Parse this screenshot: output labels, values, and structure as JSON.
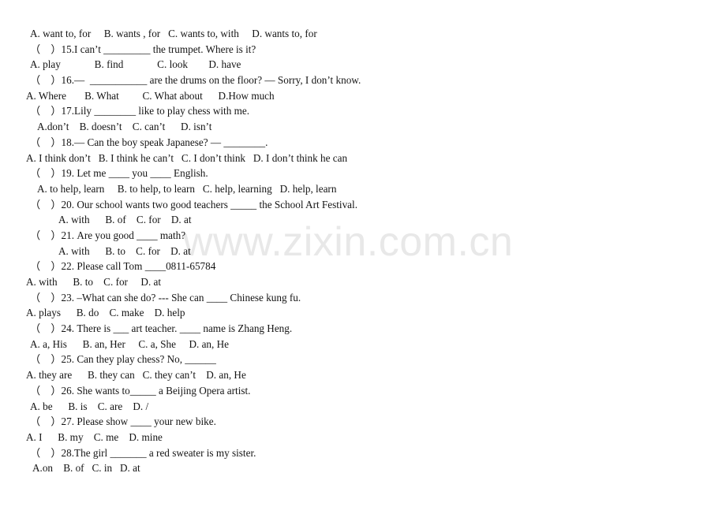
{
  "document": {
    "type": "english-grammar-worksheet",
    "watermark": {
      "text": "www.zixin.com.cn",
      "color": "#e8e8e8"
    },
    "lines": [
      {
        "id": "opts-14",
        "kind": "options",
        "indent": 1,
        "text": "A. want to, for     B. wants , for   C. wants to, with     D. wants to, for"
      },
      {
        "id": "q-15",
        "kind": "question",
        "indent": 1,
        "text": "（    ）15.I can’t _________ the trumpet. Where is it?"
      },
      {
        "id": "opts-15",
        "kind": "options",
        "indent": 1,
        "text": "A. play             B. find             C. look        D. have"
      },
      {
        "id": "q-16",
        "kind": "question",
        "indent": 1,
        "text": "（    ）16.—  ___________ are the drums on the floor? — Sorry, I don’t know."
      },
      {
        "id": "opts-16",
        "kind": "options",
        "indent": 0,
        "text": "A. Where       B. What         C. What about      D.How much"
      },
      {
        "id": "q-17",
        "kind": "question",
        "indent": 1,
        "text": "（    ）17.Lily ________ like to play chess with me."
      },
      {
        "id": "opts-17",
        "kind": "options",
        "indent": 3,
        "text": "A.don’t    B. doesn’t    C. can’t      D. isn’t"
      },
      {
        "id": "q-18",
        "kind": "question",
        "indent": 1,
        "text": "（    ）18.— Can the boy speak Japanese? — ________."
      },
      {
        "id": "opts-18",
        "kind": "options",
        "indent": 0,
        "text": "A. I think don’t   B. I think he can’t   C. I don’t think   D. I don’t think he can"
      },
      {
        "id": "q-19",
        "kind": "question",
        "indent": 1,
        "text": "（    ）19. Let me ____ you ____ English."
      },
      {
        "id": "opts-19",
        "kind": "options",
        "indent": 3,
        "text": "A. to help, learn     B. to help, to learn   C. help, learning   D. help, learn"
      },
      {
        "id": "q-20",
        "kind": "question",
        "indent": 1,
        "text": "（    ）20. Our school wants two good teachers _____ the School Art Festival."
      },
      {
        "id": "opts-20",
        "kind": "options",
        "indent": 5,
        "text": "A. with      B. of    C. for    D. at"
      },
      {
        "id": "q-21",
        "kind": "question",
        "indent": 1,
        "text": "（    ）21. Are you good ____ math?"
      },
      {
        "id": "opts-21",
        "kind": "options",
        "indent": 5,
        "text": "A. with      B. to    C. for    D. at"
      },
      {
        "id": "q-22",
        "kind": "question",
        "indent": 1,
        "text": "（    ）22. Please call Tom ____0811-65784"
      },
      {
        "id": "opts-22",
        "kind": "options",
        "indent": 0,
        "text": "A. with      B. to    C. for     D. at"
      },
      {
        "id": "q-23",
        "kind": "question",
        "indent": 1,
        "text": "（    ）23. –What can she do? --- She can ____ Chinese kung fu."
      },
      {
        "id": "opts-23",
        "kind": "options",
        "indent": 0,
        "text": "A. plays      B. do    C. make    D. help"
      },
      {
        "id": "q-24",
        "kind": "question",
        "indent": 1,
        "text": "（    ）24. There is ___ art teacher. ____ name is Zhang Heng."
      },
      {
        "id": "opts-24",
        "kind": "options",
        "indent": 1,
        "text": "A. a, His      B. an, Her     C. a, She     D. an, He"
      },
      {
        "id": "q-25",
        "kind": "question",
        "indent": 1,
        "text": "（    ）25. Can they play chess? No, ______"
      },
      {
        "id": "opts-25",
        "kind": "options",
        "indent": 0,
        "text": "A. they are      B. they can   C. they can’t    D. an, He"
      },
      {
        "id": "q-26",
        "kind": "question",
        "indent": 1,
        "text": "（    ）26. She wants to_____ a Beijing Opera artist."
      },
      {
        "id": "opts-26",
        "kind": "options",
        "indent": 1,
        "text": "A. be      B. is    C. are    D. /"
      },
      {
        "id": "q-27",
        "kind": "question",
        "indent": 1,
        "text": "（    ）27. Please show ____ your new bike."
      },
      {
        "id": "opts-27",
        "kind": "options",
        "indent": 0,
        "text": "A. I      B. my    C. me    D. mine"
      },
      {
        "id": "q-28",
        "kind": "question",
        "indent": 1,
        "text": "（    ）28.The girl _______ a red sweater is my sister."
      },
      {
        "id": "opts-28",
        "kind": "options",
        "indent": 2,
        "text": "A.on    B. of   C. in   D. at"
      }
    ]
  }
}
